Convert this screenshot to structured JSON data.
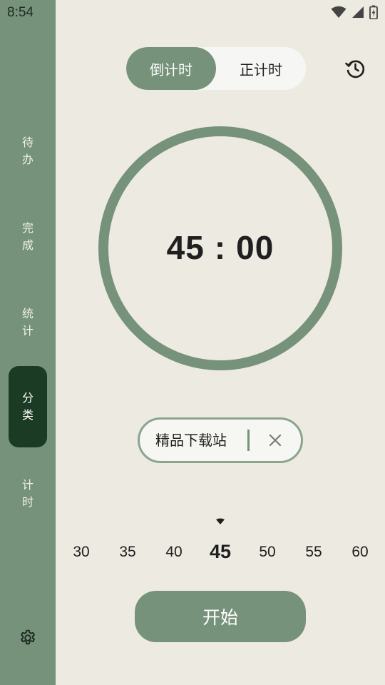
{
  "status_bar": {
    "time": "8:54"
  },
  "sidebar": {
    "items": [
      {
        "label_1": "待",
        "label_2": "办"
      },
      {
        "label_1": "完",
        "label_2": "成"
      },
      {
        "label_1": "统",
        "label_2": "计"
      },
      {
        "label_1": "分",
        "label_2": "类"
      },
      {
        "label_1": "计",
        "label_2": "时"
      }
    ],
    "active_index": 3
  },
  "mode_toggle": {
    "countdown": "倒计时",
    "countup": "正计时",
    "selected": "倒计时"
  },
  "timer": {
    "minutes": "45",
    "separator": ":",
    "seconds": "00"
  },
  "category_tag": {
    "label": "精品下载站"
  },
  "duration_picker": {
    "options": [
      "30",
      "35",
      "40",
      "45",
      "50",
      "55",
      "60"
    ],
    "selected": "45"
  },
  "start_button": {
    "label": "开始"
  },
  "colors": {
    "accent": "#76927a",
    "active_nav": "#1c3b24",
    "background": "#edeae1"
  },
  "icons": [
    "wifi-icon",
    "signal-icon",
    "battery-charging-icon",
    "history-icon",
    "close-icon",
    "settings-icon",
    "dropdown-arrow-icon"
  ]
}
